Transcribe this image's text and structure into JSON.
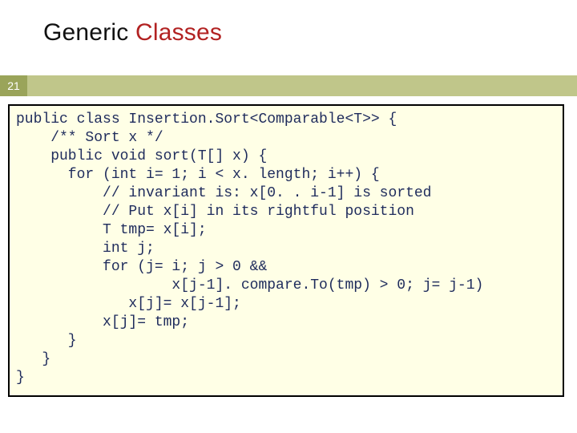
{
  "slide": {
    "title_plain": "Generic ",
    "title_kw": "Classes",
    "page_number": "21",
    "code": "public class Insertion.Sort<Comparable<T>> {\n    /** Sort x */\n    public void sort(T[] x) {\n      for (int i= 1; i < x. length; i++) {\n          // invariant is: x[0. . i-1] is sorted\n          // Put x[i] in its rightful position\n          T tmp= x[i];\n          int j;\n          for (j= i; j > 0 &&\n                  x[j-1]. compare.To(tmp) > 0; j= j-1)\n             x[j]= x[j-1];\n          x[j]= tmp;\n      }\n   }\n}"
  }
}
